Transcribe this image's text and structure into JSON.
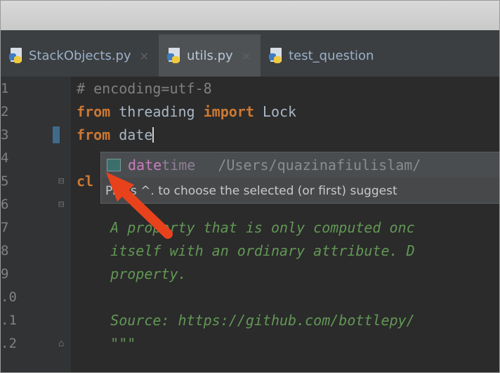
{
  "tabs": [
    {
      "label": "StackObjects.py",
      "close": "×"
    },
    {
      "label": "utils.py",
      "close": "×"
    },
    {
      "label": "test_question",
      "close": ""
    }
  ],
  "lines": [
    {
      "num": "1",
      "parts": [
        {
          "t": "# encoding=utf-8",
          "c": "cm"
        }
      ]
    },
    {
      "num": "2",
      "parts": [
        {
          "t": "from",
          "c": "kw"
        },
        {
          "t": " threading ",
          "c": ""
        },
        {
          "t": "import",
          "c": "kw"
        },
        {
          "t": " Lock",
          "c": ""
        }
      ]
    },
    {
      "num": "3",
      "parts": [
        {
          "t": "from",
          "c": "kw"
        },
        {
          "t": " date",
          "c": ""
        }
      ]
    },
    {
      "num": "4",
      "parts": []
    },
    {
      "num": "5",
      "parts": [
        {
          "t": "cl",
          "c": "kw"
        }
      ]
    },
    {
      "num": "6",
      "parts": [
        {
          "t": "    \"\"\"",
          "c": "doc"
        }
      ]
    },
    {
      "num": "7",
      "parts": [
        {
          "t": "    A property that is only computed onc",
          "c": "doc"
        }
      ]
    },
    {
      "num": "8",
      "parts": [
        {
          "t": "    itself with an ordinary attribute. D",
          "c": "doc"
        }
      ]
    },
    {
      "num": "9",
      "parts": [
        {
          "t": "    property.",
          "c": "doc"
        }
      ]
    },
    {
      "num": ".0",
      "parts": []
    },
    {
      "num": ".1",
      "parts": [
        {
          "t": "    Source: https://github.com/bottlepy/",
          "c": "doc"
        }
      ]
    },
    {
      "num": ".2",
      "parts": [
        {
          "t": "    \"\"\"",
          "c": "doc"
        }
      ]
    }
  ],
  "completion": {
    "match": "date",
    "rest": "time",
    "path": "/Users/quazinafiulislam/",
    "hint": "Press ^. to choose the selected (or first) suggest"
  },
  "colors": {
    "keyword": "#cc7832",
    "docstring": "#629755",
    "arrow": "#e8421c"
  }
}
